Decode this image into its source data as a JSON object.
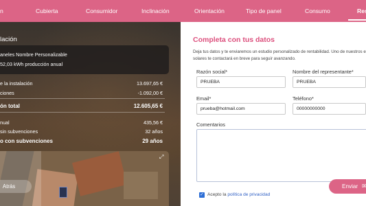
{
  "nav": {
    "tabs": [
      {
        "label": "n"
      },
      {
        "label": "Cubierta"
      },
      {
        "label": "Consumidor"
      },
      {
        "label": "Inclinación"
      },
      {
        "label": "Orientación"
      },
      {
        "label": "Tipo de panel"
      },
      {
        "label": "Consumo"
      },
      {
        "label": "Res"
      }
    ],
    "active_index": 7,
    "background_color": "#dc6486"
  },
  "left_panel": {
    "title": "lación",
    "summary": {
      "line1": "aneles Nombre Personalizable",
      "line2": "52,03 kWh producción anual"
    },
    "rows": [
      {
        "label": "e la instalación",
        "value": "13.697,65 €"
      },
      {
        "label": "ciones",
        "value": "-1.092,00 €"
      },
      {
        "label": "ón total",
        "value": "12.605,65 €"
      },
      {
        "label": "nual",
        "value": "435,56 €"
      },
      {
        "label": "sin subvenciones",
        "value": "32 años"
      },
      {
        "label": "o con subvenciones",
        "value": "29 años"
      }
    ],
    "back_button": "Atrás",
    "expand_icon": "expand-icon"
  },
  "form": {
    "title": "Completa con tus datos",
    "description": "Deja tus datos y te enviaremos un estudio personalizado de rentabilidad. Uno de nuestros ex solares te contactará en breve para seguir avanzando.",
    "fields": {
      "razon_social": {
        "label": "Razón social*",
        "value": "PRUEBA"
      },
      "representante": {
        "label": "Nombre del representante*",
        "value": "PRUEBA"
      },
      "email": {
        "label": "Email*",
        "value": "prueba@hotmail.com"
      },
      "telefono": {
        "label": "Teléfono*",
        "value": "00000000000"
      },
      "comentarios": {
        "label": "Comentarios",
        "value": ""
      }
    },
    "accept_text": "Acepto la",
    "privacy_link": "política de privacidad",
    "send_button": "Enviar",
    "accent_color": "#dc4f7d"
  }
}
